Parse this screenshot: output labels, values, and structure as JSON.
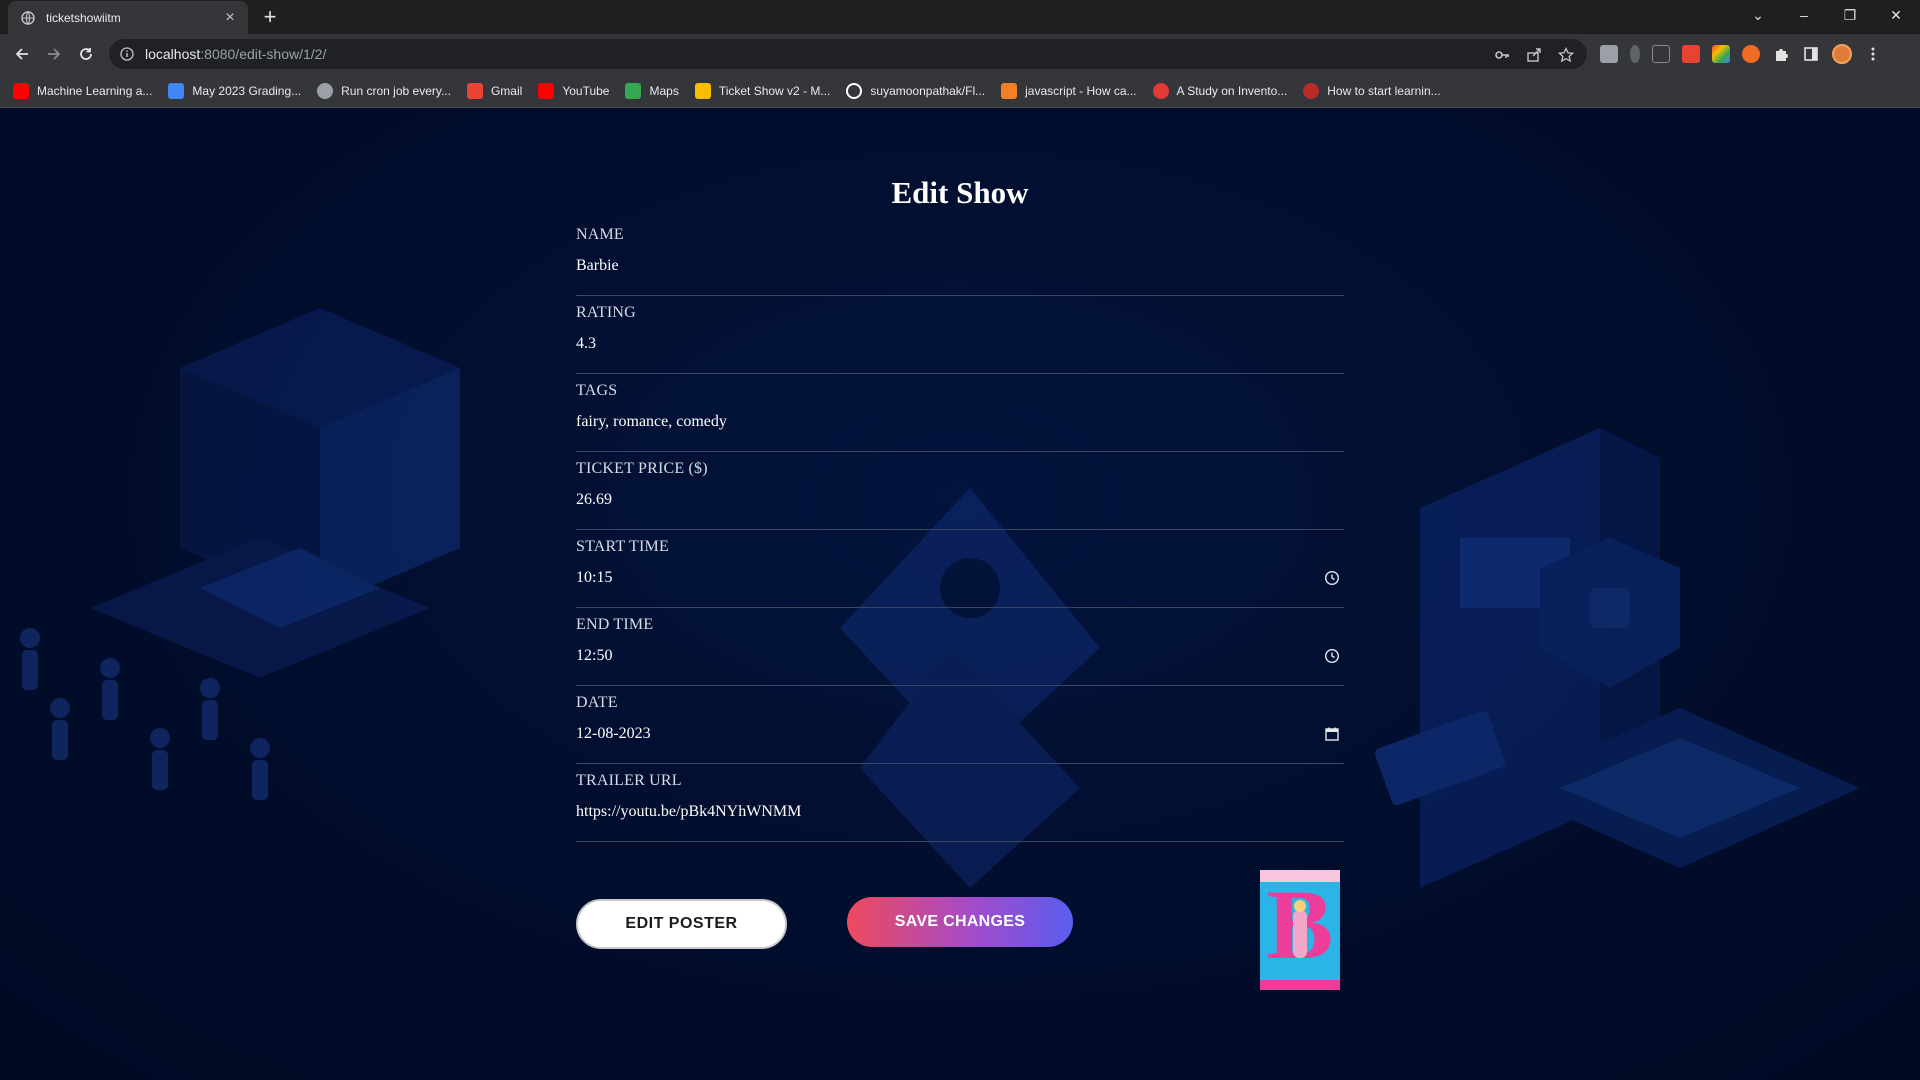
{
  "browser": {
    "tab_title": "ticketshowiitm",
    "new_tab_glyph": "+",
    "tab_close_glyph": "×",
    "url_host": "localhost",
    "url_path": ":8080/edit-show/1/2/",
    "window_controls": {
      "minimize": "–",
      "restore": "❐",
      "close": "✕",
      "tab_search": "⌄"
    }
  },
  "bookmarks": [
    {
      "label": "Machine Learning a...",
      "icon": "youtube-icon",
      "color": "#ff0000"
    },
    {
      "label": "May 2023 Grading...",
      "icon": "docs-icon",
      "color": "#4285f4"
    },
    {
      "label": "Run cron job every...",
      "icon": "globe-icon",
      "color": "#9aa0a6"
    },
    {
      "label": "Gmail",
      "icon": "gmail-icon",
      "color": "#ea4335"
    },
    {
      "label": "YouTube",
      "icon": "youtube-icon",
      "color": "#ff0000"
    },
    {
      "label": "Maps",
      "icon": "maps-icon",
      "color": "#34a853"
    },
    {
      "label": "Ticket Show v2 - M...",
      "icon": "slides-icon",
      "color": "#fbbc04"
    },
    {
      "label": "suyamoonpathak/Fl...",
      "icon": "github-icon",
      "color": "#ffffff"
    },
    {
      "label": "javascript - How ca...",
      "icon": "stackoverflow-icon",
      "color": "#f48024"
    },
    {
      "label": "A Study on Invento...",
      "icon": "target-icon",
      "color": "#e53935"
    },
    {
      "label": "How to start learnin...",
      "icon": "quora-icon",
      "color": "#b92b27"
    }
  ],
  "form": {
    "title": "Edit Show",
    "fields": [
      {
        "label": "NAME",
        "value": "Barbie",
        "icon": ""
      },
      {
        "label": "RATING",
        "value": "4.3",
        "icon": ""
      },
      {
        "label": "TAGS",
        "value": "fairy, romance, comedy",
        "icon": ""
      },
      {
        "label": "TICKET PRICE ($)",
        "value": "26.69",
        "icon": ""
      },
      {
        "label": "START TIME",
        "value": "10:15",
        "icon": "clock-icon"
      },
      {
        "label": "END TIME",
        "value": "12:50",
        "icon": "clock-icon"
      },
      {
        "label": "DATE",
        "value": "12-08-2023",
        "icon": "calendar-icon"
      },
      {
        "label": "TRAILER URL",
        "value": "https://youtu.be/pBk4NYhWNMM",
        "icon": ""
      }
    ],
    "edit_poster_label": "EDIT POSTER",
    "save_label": "SAVE CHANGES"
  },
  "colors": {
    "page_bg": "#010d2c",
    "save_gradient_start": "#ee4a5d",
    "save_gradient_end": "#5a5df0",
    "poster_pink": "#ec3d9a"
  }
}
